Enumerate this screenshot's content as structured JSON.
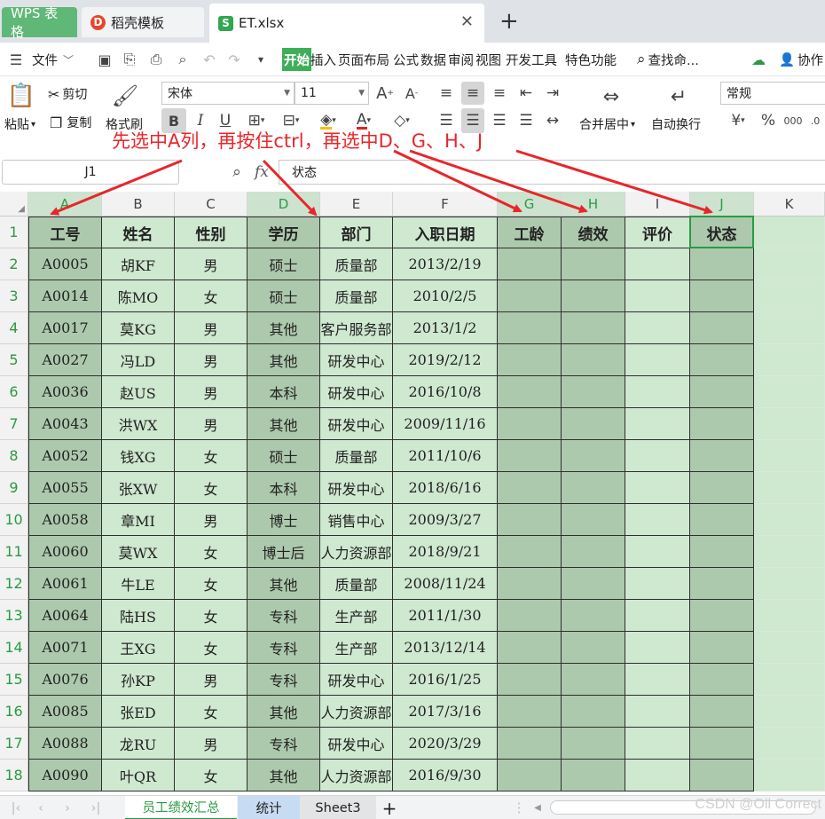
{
  "tabs": {
    "wps": "WPS 表格",
    "template": "稻壳模板",
    "file": "ET.xlsx",
    "file_icon": "S",
    "template_icon": "D"
  },
  "menubar": {
    "file_menu": "文件",
    "items": [
      "开始",
      "插入",
      "页面布局",
      "公式",
      "数据",
      "审阅",
      "视图",
      "开发工具",
      "特色功能"
    ],
    "search": "查找命...",
    "collab": "协作"
  },
  "ribbon": {
    "paste": "粘贴",
    "cut": "剪切",
    "copy": "复制",
    "format_painter": "格式刷",
    "font_name": "宋体",
    "font_size": "11",
    "bold": "B",
    "italic": "I",
    "underline": "U",
    "merge_center": "合并居中",
    "wrap_text": "自动换行",
    "number_format": "常规"
  },
  "formula": {
    "cell_ref": "J1",
    "fx": "fx",
    "content": "状态"
  },
  "annotation": "先选中A列，再按住ctrl，再选中D、G、H、J",
  "columns": [
    "A",
    "B",
    "C",
    "D",
    "E",
    "F",
    "G",
    "H",
    "I",
    "J",
    "K"
  ],
  "headers": [
    "工号",
    "姓名",
    "性别",
    "学历",
    "部门",
    "入职日期",
    "工龄",
    "绩效",
    "评价",
    "状态"
  ],
  "rows": [
    [
      "A0005",
      "胡KF",
      "男",
      "硕士",
      "质量部",
      "2013/2/19"
    ],
    [
      "A0014",
      "陈MO",
      "女",
      "硕士",
      "质量部",
      "2010/2/5"
    ],
    [
      "A0017",
      "莫KG",
      "男",
      "其他",
      "客户服务部",
      "2013/1/2"
    ],
    [
      "A0027",
      "冯LD",
      "男",
      "其他",
      "研发中心",
      "2019/2/12"
    ],
    [
      "A0036",
      "赵US",
      "男",
      "本科",
      "研发中心",
      "2016/10/8"
    ],
    [
      "A0043",
      "洪WX",
      "男",
      "其他",
      "研发中心",
      "2009/11/16"
    ],
    [
      "A0052",
      "钱XG",
      "女",
      "硕士",
      "质量部",
      "2011/10/6"
    ],
    [
      "A0055",
      "张XW",
      "女",
      "本科",
      "研发中心",
      "2018/6/16"
    ],
    [
      "A0058",
      "章MI",
      "男",
      "博士",
      "销售中心",
      "2009/3/27"
    ],
    [
      "A0060",
      "莫WX",
      "女",
      "博士后",
      "人力资源部",
      "2018/9/21"
    ],
    [
      "A0061",
      "牛LE",
      "女",
      "其他",
      "质量部",
      "2008/11/24"
    ],
    [
      "A0064",
      "陆HS",
      "女",
      "专科",
      "生产部",
      "2011/1/30"
    ],
    [
      "A0071",
      "王XG",
      "女",
      "专科",
      "生产部",
      "2013/12/14"
    ],
    [
      "A0076",
      "孙KP",
      "男",
      "专科",
      "研发中心",
      "2016/1/25"
    ],
    [
      "A0085",
      "张ED",
      "女",
      "其他",
      "人力资源部",
      "2017/3/16"
    ],
    [
      "A0088",
      "龙RU",
      "男",
      "专科",
      "研发中心",
      "2020/3/29"
    ],
    [
      "A0090",
      "叶QR",
      "女",
      "其他",
      "人力资源部",
      "2016/9/30"
    ]
  ],
  "sheet_tabs": [
    "员工绩效汇总",
    "统计",
    "Sheet3"
  ],
  "watermark": "CSDN @Oll Correct",
  "colors": {
    "accent": "#3fae5a",
    "selected_fill": "#adc9ad",
    "sheet_fill": "#cfe8d0",
    "annotation": "#e8262a"
  }
}
